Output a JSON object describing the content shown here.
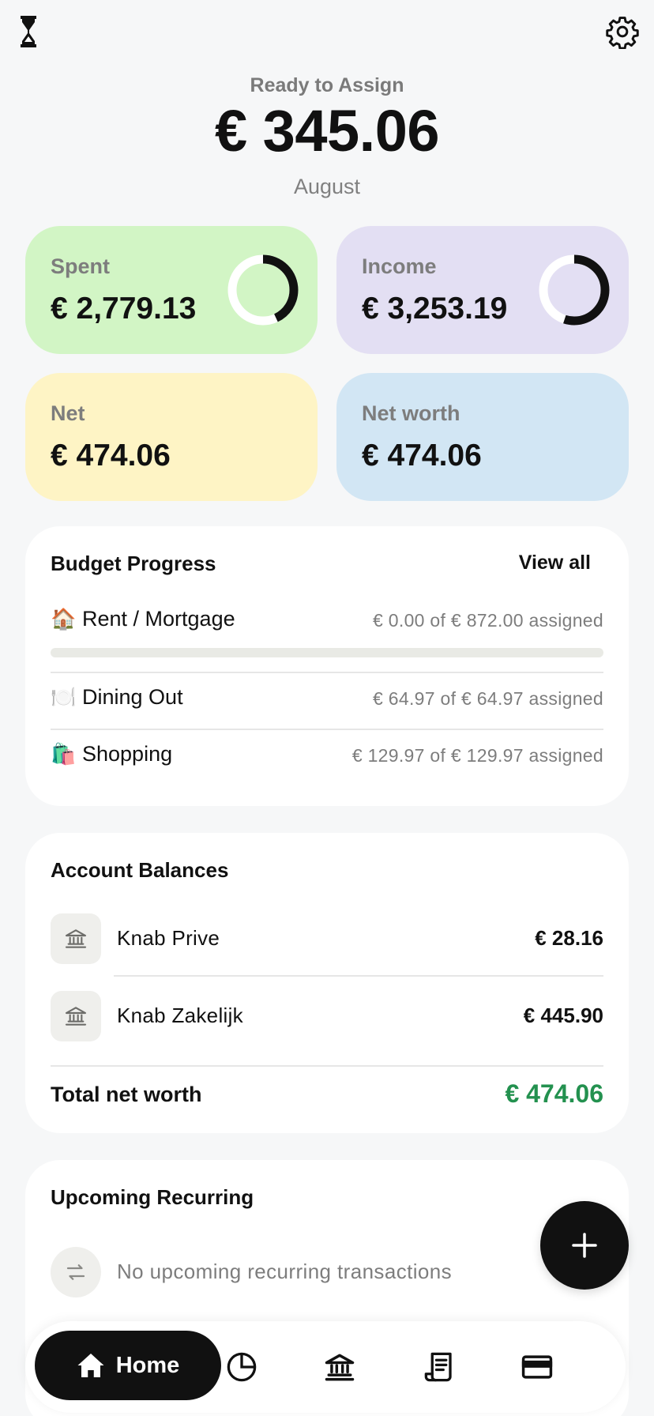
{
  "header": {
    "label": "Ready to Assign",
    "amount": "€ 345.06",
    "month": "August"
  },
  "stats": {
    "spent": {
      "label": "Spent",
      "value": "€ 2,779.13",
      "ring_fraction": 0.43
    },
    "income": {
      "label": "Income",
      "value": "€ 3,253.19",
      "ring_fraction": 0.55
    },
    "net": {
      "label": "Net",
      "value": "€ 474.06"
    },
    "networth": {
      "label": "Net worth",
      "value": "€ 474.06"
    }
  },
  "budget": {
    "title": "Budget Progress",
    "view_all": "View all",
    "items": [
      {
        "emoji": "🏠",
        "name": "Rent / Mortgage",
        "amount": "€ 0.00 of € 872.00 assigned",
        "progress": 0
      },
      {
        "emoji": "🍽️",
        "name": "Dining Out",
        "amount": "€ 64.97 of € 64.97 assigned"
      },
      {
        "emoji": "🛍️",
        "name": "Shopping",
        "amount": "€ 129.97 of € 129.97 assigned"
      }
    ]
  },
  "accounts": {
    "title": "Account Balances",
    "items": [
      {
        "name": "Knab Prive",
        "balance": "€ 28.16",
        "icon": "bank-icon"
      },
      {
        "name": "Knab Zakelijk",
        "balance": "€ 445.90",
        "icon": "bank-icon"
      }
    ],
    "total_label": "Total net worth",
    "total_value": "€ 474.06"
  },
  "recurring": {
    "title": "Upcoming Recurring",
    "empty_text": "No upcoming recurring transactions",
    "icon": "repeat-icon"
  },
  "nav": {
    "home_label": "Home",
    "items": [
      "home-icon",
      "budget-pie-icon",
      "bank-icon",
      "receipt-icon",
      "card-icon"
    ]
  },
  "colors": {
    "spent_bg": "#d2f5c5",
    "income_bg": "#e3dff3",
    "net_bg": "#fef4c5",
    "networth_bg": "#d2e6f4",
    "positive": "#23914f",
    "accent": "#111111"
  }
}
